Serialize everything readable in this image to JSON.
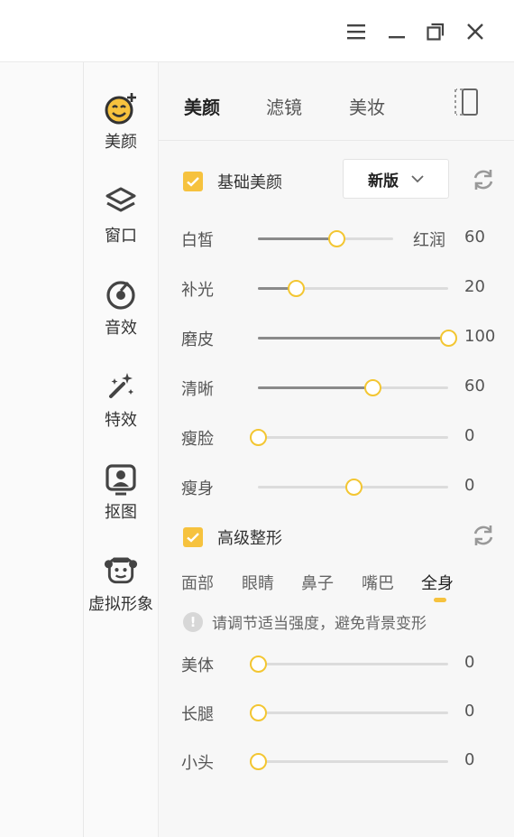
{
  "window_controls": {
    "menu_icon": "hamburger-icon",
    "minimize_icon": "minimize-icon",
    "restore_icon": "restore-icon",
    "close_icon": "close-icon"
  },
  "sidebar": {
    "items": [
      {
        "label": "美颜",
        "icon": "beauty-face-icon"
      },
      {
        "label": "窗口",
        "icon": "layers-icon"
      },
      {
        "label": "音效",
        "icon": "music-disc-icon"
      },
      {
        "label": "特效",
        "icon": "magic-wand-icon"
      },
      {
        "label": "抠图",
        "icon": "portrait-cutout-icon"
      },
      {
        "label": "虚拟形象",
        "icon": "avatar-icon"
      }
    ]
  },
  "tabs": [
    "美颜",
    "滤镜",
    "美妆"
  ],
  "basic": {
    "label": "基础美颜",
    "checked": true,
    "version": "新版",
    "sliders": [
      {
        "label": "白皙",
        "right_label": "红润",
        "value": "60",
        "position": 0.58
      },
      {
        "label": "补光",
        "right_label": "",
        "value": "20",
        "position": 0.2
      },
      {
        "label": "磨皮",
        "right_label": "",
        "value": "100",
        "position": 1.0
      },
      {
        "label": "清晰",
        "right_label": "",
        "value": "60",
        "position": 0.6
      },
      {
        "label": "瘦脸",
        "right_label": "",
        "value": "0",
        "position": 0.0
      },
      {
        "label": "瘦身",
        "right_label": "",
        "value": "0",
        "position": 0.5
      }
    ]
  },
  "advanced": {
    "label": "高级整形",
    "checked": true,
    "subtabs": [
      "面部",
      "眼睛",
      "鼻子",
      "嘴巴",
      "全身"
    ],
    "active_subtab": "全身",
    "hint": "请调节适当强度，避免背景变形",
    "sliders": [
      {
        "label": "美体",
        "value": "0",
        "position": 0.0
      },
      {
        "label": "长腿",
        "value": "0",
        "position": 0.0
      },
      {
        "label": "小头",
        "value": "0",
        "position": 0.0
      }
    ]
  },
  "colors": {
    "accent": "#f6c23e",
    "thumb_border": "#f3c632",
    "track": "#dcdcdc",
    "track_fill": "#8a8a8a"
  }
}
